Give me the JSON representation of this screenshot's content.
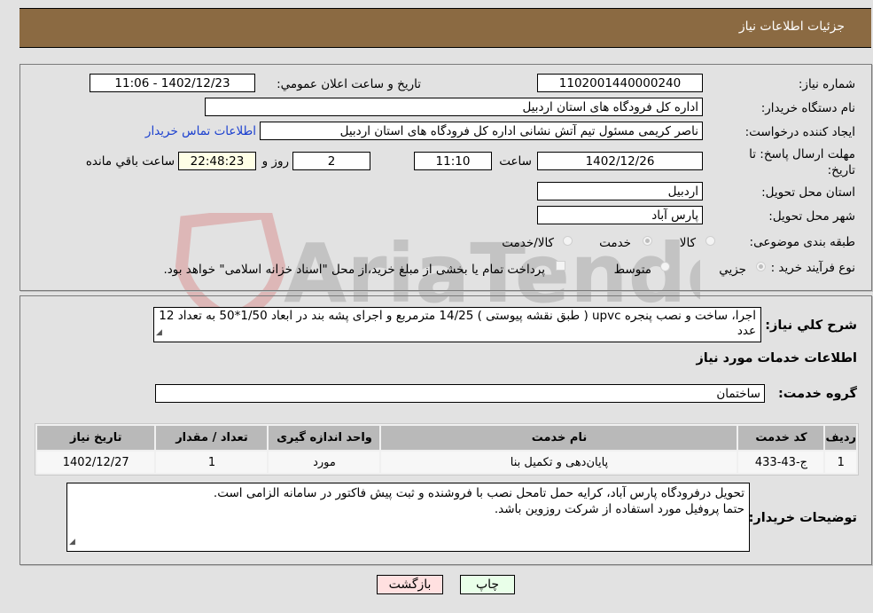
{
  "header": {
    "title": "جزئیات اطلاعات نیاز"
  },
  "details": {
    "need_number_label": "شماره نیاز:",
    "need_number": "1102001440000240",
    "announce_label": "تاريخ و ساعت اعلان عمومي:",
    "announce_value": "1402/12/23 - 11:06",
    "buyer_org_label": "نام دستگاه خريدار:",
    "buyer_org": "اداره کل فرودگاه های استان اردبیل",
    "creator_label": "ايجاد کننده درخواست:",
    "creator": "ناصر کریمی مسئول تیم آتش نشانی اداره کل فرودگاه های استان اردبیل",
    "contact_link": "اطلاعات تماس خريدار",
    "deadline_label": "مهلت ارسال پاسخ: تا تاریخ:",
    "deadline_date": "1402/12/26",
    "time_label": "ساعت",
    "deadline_time": "11:10",
    "days_value": "2",
    "days_label": "روز و",
    "remaining_time": "22:48:23",
    "remaining_label": "ساعت باقي مانده",
    "province_label": "استان محل تحویل:",
    "province": "اردبیل",
    "city_label": "شهر محل تحویل:",
    "city": "پارس آباد",
    "category_label": "طبقه بندی موضوعی:",
    "category_options": [
      {
        "label": "کالا",
        "selected": false
      },
      {
        "label": "خدمت",
        "selected": true
      },
      {
        "label": "کالا/خدمت",
        "selected": false
      }
    ],
    "process_label": "نوع فرآيند خريد :",
    "process_options": [
      {
        "label": "جزيي",
        "selected": true
      },
      {
        "label": "متوسط",
        "selected": false
      }
    ],
    "treasury_note": "پرداخت تمام یا بخشی از مبلغ خرید،از محل \"اسناد خزانه اسلامی\" خواهد بود.",
    "treasury_checked": false
  },
  "description": {
    "label": "شرح کلي نياز:",
    "text": "اجرا، ساخت و نصب پنجره upvc ( طبق نقشه پیوستی ) 14/25 مترمربع و اجرای پشه بند در ابعاد 1/50*50 به تعداد 12 عدد"
  },
  "services": {
    "section_title": "اطلاعات خدمات مورد نياز",
    "group_label": "گروه خدمت:",
    "group_value": "ساختمان",
    "columns": [
      "رديف",
      "کد خدمت",
      "نام خدمت",
      "واحد اندازه گيری",
      "تعداد / مقدار",
      "تاريخ نياز"
    ],
    "rows": [
      [
        "1",
        "ج-43-433",
        "پایان‌دهی و تکمیل بنا",
        "مورد",
        "1",
        "1402/12/27"
      ]
    ]
  },
  "buyer_notes": {
    "label": "توضيحات خريدار:",
    "lines": [
      "تحویل درفرودگاه پارس آباد، کرایه حمل تامحل نصب با فروشنده و ثبت پیش فاکتور در سامانه الزامی است.",
      "حتما پروفیل مورد استفاده از شرکت روزوین باشد."
    ]
  },
  "buttons": {
    "print": "چاپ",
    "back": "بازگشت"
  },
  "watermark": {
    "text": "AriaTender.neT"
  },
  "colors": {
    "header_bg": "#8b6a42",
    "print_bg": "#e9ffe9",
    "back_bg": "#ffe0e0",
    "link": "#1a3fcf"
  }
}
